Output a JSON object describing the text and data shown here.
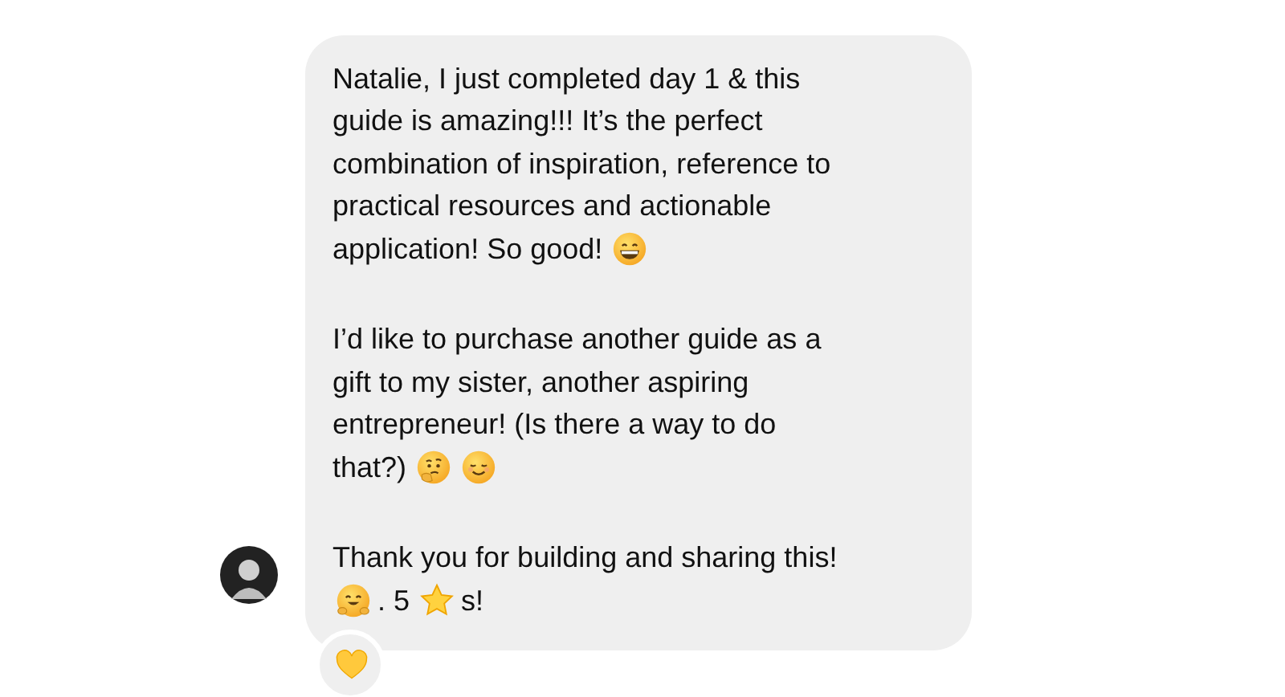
{
  "message": {
    "paragraphs": [
      [
        [
          {
            "kind": "text",
            "text": "Natalie, I just completed day 1 & this"
          }
        ],
        [
          {
            "kind": "text",
            "text": "guide is amazing!!! It’s the perfect"
          }
        ],
        [
          {
            "kind": "text",
            "text": "combination of inspiration, reference to"
          }
        ],
        [
          {
            "kind": "text",
            "text": "practical resources and actionable"
          }
        ],
        [
          {
            "kind": "text",
            "text": "application! So good!"
          },
          {
            "kind": "grin"
          }
        ]
      ],
      [
        [
          {
            "kind": "text",
            "text": "I’d like to purchase another guide as a"
          }
        ],
        [
          {
            "kind": "text",
            "text": "gift to my sister, another aspiring"
          }
        ],
        [
          {
            "kind": "text",
            "text": "entrepreneur! (Is there a way to do"
          }
        ],
        [
          {
            "kind": "text",
            "text": "that?)"
          },
          {
            "kind": "think"
          },
          {
            "kind": "smile"
          }
        ]
      ],
      [
        [
          {
            "kind": "text",
            "text": "Thank you for building and sharing this!"
          }
        ],
        [
          {
            "kind": "hug"
          },
          {
            "kind": "text",
            "text": ". 5"
          },
          {
            "kind": "star"
          },
          {
            "kind": "text",
            "text": "s!"
          }
        ]
      ]
    ],
    "reaction": {
      "kind": "heart"
    }
  }
}
